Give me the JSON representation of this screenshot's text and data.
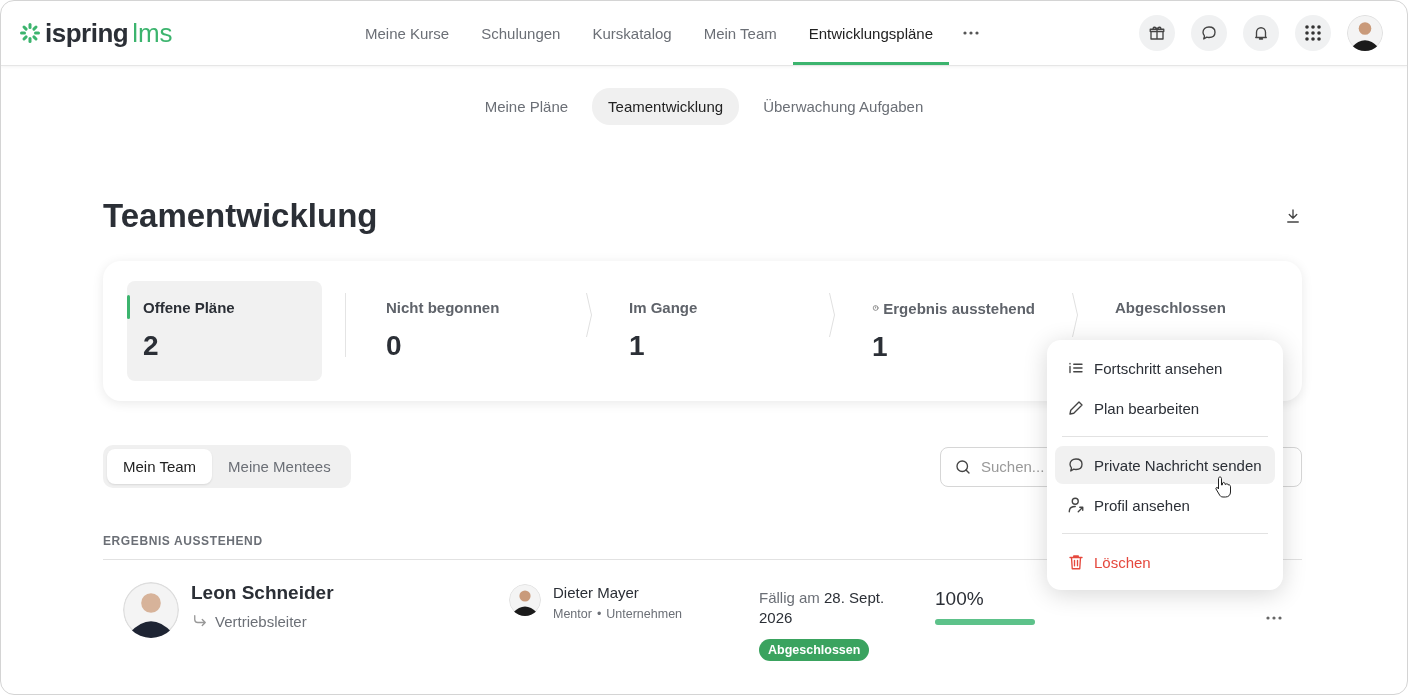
{
  "logo": {
    "brand": "ispring",
    "product": "lms"
  },
  "nav": [
    {
      "label": "Meine Kurse",
      "selected": false
    },
    {
      "label": "Schulungen",
      "selected": false
    },
    {
      "label": "Kurskatalog",
      "selected": false
    },
    {
      "label": "Mein Team",
      "selected": false
    },
    {
      "label": "Entwicklungspläne",
      "selected": true
    }
  ],
  "subtabs": [
    {
      "label": "Meine Pläne",
      "selected": false
    },
    {
      "label": "Teamentwicklung",
      "selected": true
    },
    {
      "label": "Überwachung Aufgaben",
      "selected": false
    }
  ],
  "page_title": "Teamentwicklung",
  "stats": [
    {
      "label": "Offene Pläne",
      "value": "2",
      "selected": true,
      "kind": "plain"
    },
    {
      "label": "Nicht begonnen",
      "value": "0",
      "selected": false,
      "kind": "plain"
    },
    {
      "label": "Im Gange",
      "value": "1",
      "selected": false,
      "kind": "plain"
    },
    {
      "label": "Ergebnis ausstehend",
      "value": "1",
      "selected": false,
      "kind": "clock"
    },
    {
      "label": "Abgeschlossen",
      "selected": false,
      "kind": "plain"
    }
  ],
  "team_toggle": [
    {
      "label": "Mein Team",
      "selected": true
    },
    {
      "label": "Meine Mentees",
      "selected": false
    }
  ],
  "search": {
    "placeholder": "Suchen..."
  },
  "section_label": "ERGEBNIS AUSSTEHEND",
  "rows": [
    {
      "name": "Leon Schneider",
      "position": "Vertriebsleiter",
      "mentor": "Dieter Mayer",
      "mentor_role": "Mentor",
      "separator": "•",
      "mentor_org": "Unternehmen",
      "due_label": "Fällig am",
      "due_date": "28. Sept. 2026",
      "status": "Abgeschlossen",
      "percent": "100%",
      "level": 1
    }
  ],
  "menu": [
    {
      "label": "Fortschritt ansehen",
      "kind": "list",
      "selected": false
    },
    {
      "label": "Plan bearbeiten",
      "kind": "edit",
      "selected": false
    },
    {
      "label": "Private Nachricht senden",
      "kind": "message",
      "selected": true
    },
    {
      "label": "Profil ansehen",
      "kind": "profile",
      "selected": false
    },
    {
      "label": "Löschen",
      "kind": "delete",
      "selected": false
    }
  ]
}
